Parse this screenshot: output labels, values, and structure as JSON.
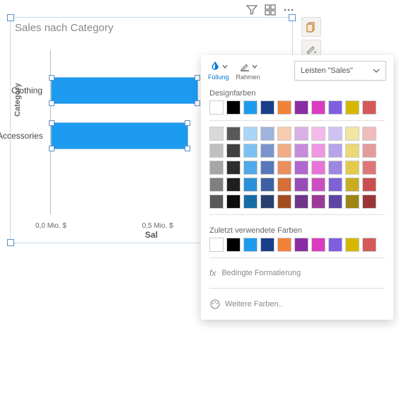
{
  "chart": {
    "title": "Sales nach Category",
    "y_axis_title": "Category",
    "x_axis_title": "Sal",
    "x_ticks": [
      "0,0 Mio. $",
      "0,5 Mio. $"
    ],
    "bar_color": "#1d9bf0"
  },
  "chart_data": {
    "type": "bar",
    "orientation": "horizontal",
    "title": "Sales nach Category",
    "xlabel": "Sales",
    "ylabel": "Category",
    "categories": [
      "Clothing",
      "Accessories"
    ],
    "values": [
      0.75,
      0.7
    ],
    "unit": "Mio. $",
    "xlim": [
      0.0,
      1.0
    ]
  },
  "popover": {
    "tab_fill": "Füllung",
    "tab_outline": "Rahmen",
    "scope_label": "Leisten \"Sales\"",
    "section_theme": "Designfarben",
    "section_recent": "Zuletzt verwendete Farben",
    "conditional": "Bedingte Formatierung",
    "more_colors": "Weitere Farben..",
    "theme_colors": [
      "#ffffff",
      "#000000",
      "#1d9bf0",
      "#1a3e8c",
      "#f2813a",
      "#8a2da5",
      "#d93cc1",
      "#7d5fe0",
      "#d6b700",
      "#d45a5a"
    ],
    "shade_rows": [
      [
        "#d9d9d9",
        "#595959",
        "#a9d5f7",
        "#9fb3dd",
        "#f7cbb0",
        "#d9b0e5",
        "#f4b9eb",
        "#cfc2f2",
        "#f2e6a3",
        "#f0bcbc"
      ],
      [
        "#bfbfbf",
        "#404040",
        "#7cc1f2",
        "#7a95cc",
        "#f2ac86",
        "#c68bdb",
        "#ee96e1",
        "#b6a3ea",
        "#ebd876",
        "#e79a9a"
      ],
      [
        "#a6a6a6",
        "#2e2e2e",
        "#4fa9ea",
        "#5678bb",
        "#eb8f5d",
        "#b266d0",
        "#e773d7",
        "#9d85e2",
        "#e4ca49",
        "#de7878"
      ],
      [
        "#808080",
        "#1f1f1f",
        "#2a8fd8",
        "#3d5fa3",
        "#d46f36",
        "#964db8",
        "#cb4fc1",
        "#7e63d4",
        "#c9ad23",
        "#c94f4f"
      ],
      [
        "#595959",
        "#0d0d0d",
        "#176da8",
        "#28406f",
        "#a24d1f",
        "#6f368a",
        "#9b3a94",
        "#5d46a3",
        "#9c8516",
        "#9c3535"
      ]
    ],
    "recent_colors": [
      "#ffffff",
      "#000000",
      "#1d9bf0",
      "#1a3e8c",
      "#f2813a",
      "#8a2da5",
      "#d93cc1",
      "#7d5fe0",
      "#d6b700",
      "#d45a5a"
    ]
  }
}
